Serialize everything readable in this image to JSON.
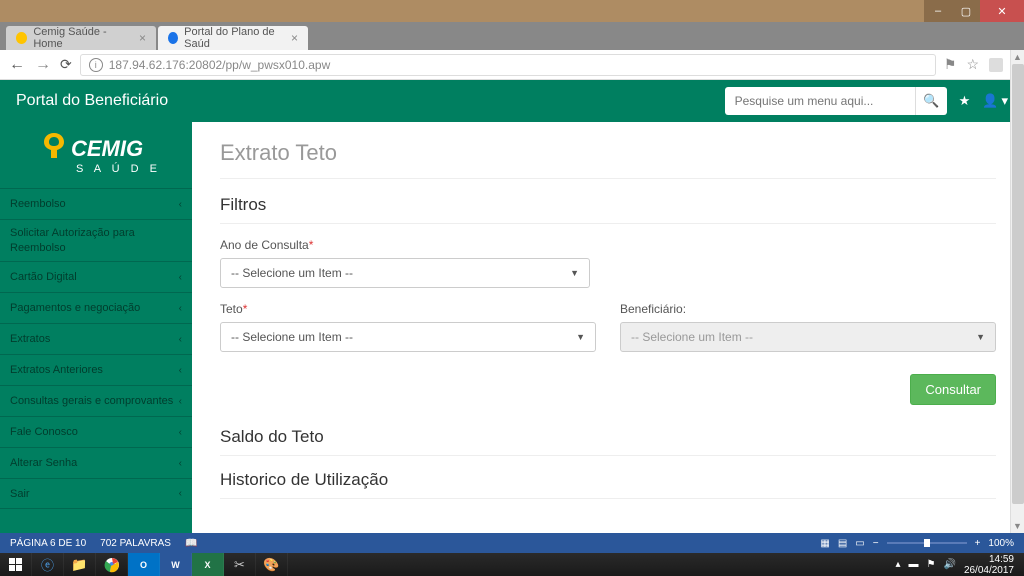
{
  "window": {
    "minimize": "–",
    "maximize": "▢",
    "close": "✕"
  },
  "tabs": [
    {
      "title": "Cemig Saúde - Home",
      "active": false
    },
    {
      "title": "Portal do Plano de Saúd",
      "active": true
    }
  ],
  "url": "187.94.62.176:20802/pp/w_pwsx010.apw",
  "portal": {
    "title": "Portal do Beneficiário",
    "search_placeholder": "Pesquise um menu aqui..."
  },
  "logo": {
    "brand": "CEMIG",
    "sub": "S A Ú D E"
  },
  "sidebar": [
    {
      "label": "Reembolso",
      "chevron": true
    },
    {
      "label": "Solicitar Autorização para Reembolso",
      "chevron": false,
      "tall": true
    },
    {
      "label": "Cartão Digital",
      "chevron": true
    },
    {
      "label": "Pagamentos e negociação",
      "chevron": true
    },
    {
      "label": "Extratos",
      "chevron": true
    },
    {
      "label": "Extratos Anteriores",
      "chevron": true
    },
    {
      "label": "Consultas gerais e comprovantes",
      "chevron": true
    },
    {
      "label": "Fale Conosco",
      "chevron": true
    },
    {
      "label": "Alterar Senha",
      "chevron": true
    },
    {
      "label": "Sair",
      "chevron": true
    }
  ],
  "content": {
    "page_title": "Extrato Teto",
    "filters_title": "Filtros",
    "ano_label": "Ano de Consulta",
    "teto_label": "Teto",
    "beneficiario_label": "Beneficiário:",
    "select_placeholder": "-- Selecione um Item --",
    "consultar": "Consultar",
    "saldo_title": "Saldo do Teto",
    "historico_title": "Historico de Utilização"
  },
  "word_status": {
    "page": "PÁGINA 6 DE 10",
    "words": "702 PALAVRAS",
    "lang_icon": "▢",
    "zoom": "100%"
  },
  "system_tray": {
    "time": "14:59",
    "date": "26/04/2017"
  }
}
